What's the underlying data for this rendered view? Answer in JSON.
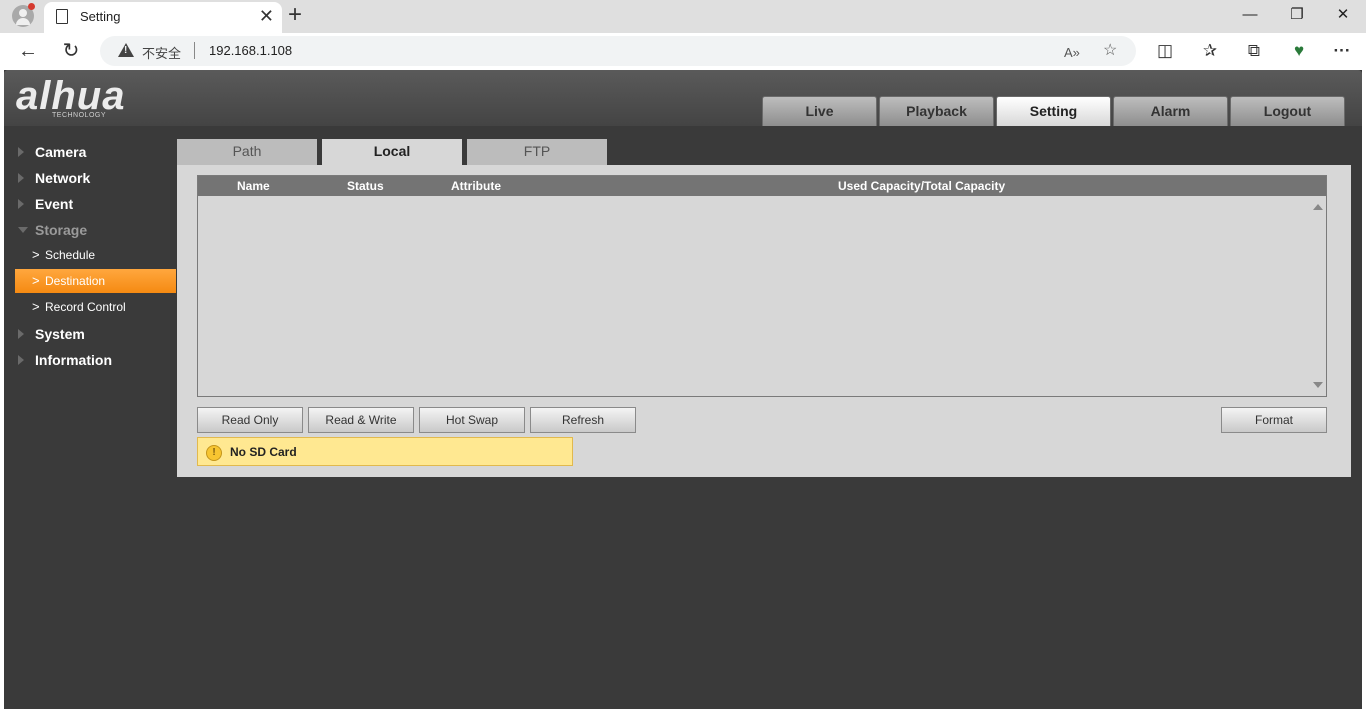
{
  "browser": {
    "tab_title": "Setting",
    "tab_close": "✕",
    "new_tab": "+",
    "window_controls": {
      "minimize": "—",
      "restore": "❐",
      "close": "✕"
    },
    "nav": {
      "back": "←",
      "reload": "↻"
    },
    "address": {
      "security_label": "不安全",
      "url": "192.168.1.108"
    },
    "url_icons": {
      "read_aloud": "A»",
      "favorite": "☆"
    },
    "toolbar_icons": {
      "split": "◫",
      "favorites": "✰",
      "collections": "⧉",
      "extension": "♥",
      "more": "···"
    }
  },
  "app": {
    "brand": {
      "logo_text": "alhua",
      "logo_subtext": "TECHNOLOGY"
    },
    "main_tabs": [
      {
        "label": "Live"
      },
      {
        "label": "Playback"
      },
      {
        "label": "Setting"
      },
      {
        "label": "Alarm"
      },
      {
        "label": "Logout"
      }
    ],
    "active_main_tab": "Setting",
    "sidebar": {
      "groups": [
        {
          "label": "Camera"
        },
        {
          "label": "Network"
        },
        {
          "label": "Event"
        },
        {
          "label": "Storage"
        },
        {
          "label": "System"
        },
        {
          "label": "Information"
        }
      ],
      "storage_items": [
        {
          "label": "Schedule"
        },
        {
          "label": "Destination"
        },
        {
          "label": "Record Control"
        }
      ],
      "active_item": "Destination",
      "sub_chevron": ">"
    },
    "content_tabs": [
      {
        "label": "Path"
      },
      {
        "label": "Local"
      },
      {
        "label": "FTP"
      }
    ],
    "active_content_tab": "Local",
    "table": {
      "columns": [
        "Name",
        "Status",
        "Attribute",
        "Used Capacity/Total Capacity"
      ],
      "rows": []
    },
    "buttons": {
      "read_only": "Read Only",
      "read_write": "Read & Write",
      "hot_swap": "Hot Swap",
      "refresh": "Refresh",
      "format": "Format"
    },
    "notice": {
      "icon_glyph": "!",
      "text": "No SD Card"
    },
    "colors": {
      "accent": "#f58a12",
      "notice_bg": "#ffe891",
      "page_bg": "#3a3a3a"
    }
  }
}
